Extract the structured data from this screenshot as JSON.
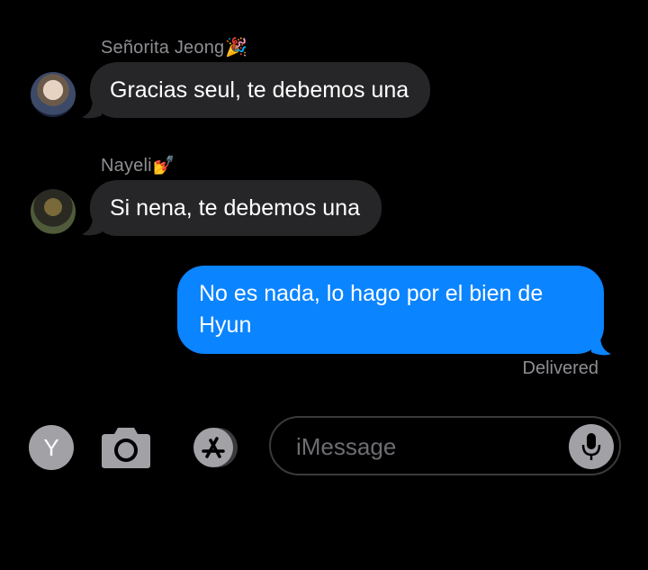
{
  "conversation": {
    "messages": [
      {
        "sender": "Señorita Jeong",
        "sender_emoji": "🎉",
        "text": "Gracias seul, te debemos una",
        "direction": "incoming"
      },
      {
        "sender": "Nayeli",
        "sender_emoji": "💅",
        "text": "Si nena, te debemos una",
        "direction": "incoming"
      },
      {
        "text": "No es nada, lo hago por el bien de Hyun",
        "direction": "outgoing"
      }
    ],
    "status": "Delivered"
  },
  "toolbar": {
    "apps_button_label": "Y",
    "camera_icon": "camera-icon",
    "app_store_icon": "app-store-icon"
  },
  "composer": {
    "placeholder": "iMessage",
    "mic_icon": "microphone-icon"
  },
  "colors": {
    "background": "#000000",
    "incoming_bubble": "#262628",
    "outgoing_bubble": "#0B84FF",
    "secondary_text": "#8E8E93",
    "icon_gray": "#A1A1A6"
  }
}
